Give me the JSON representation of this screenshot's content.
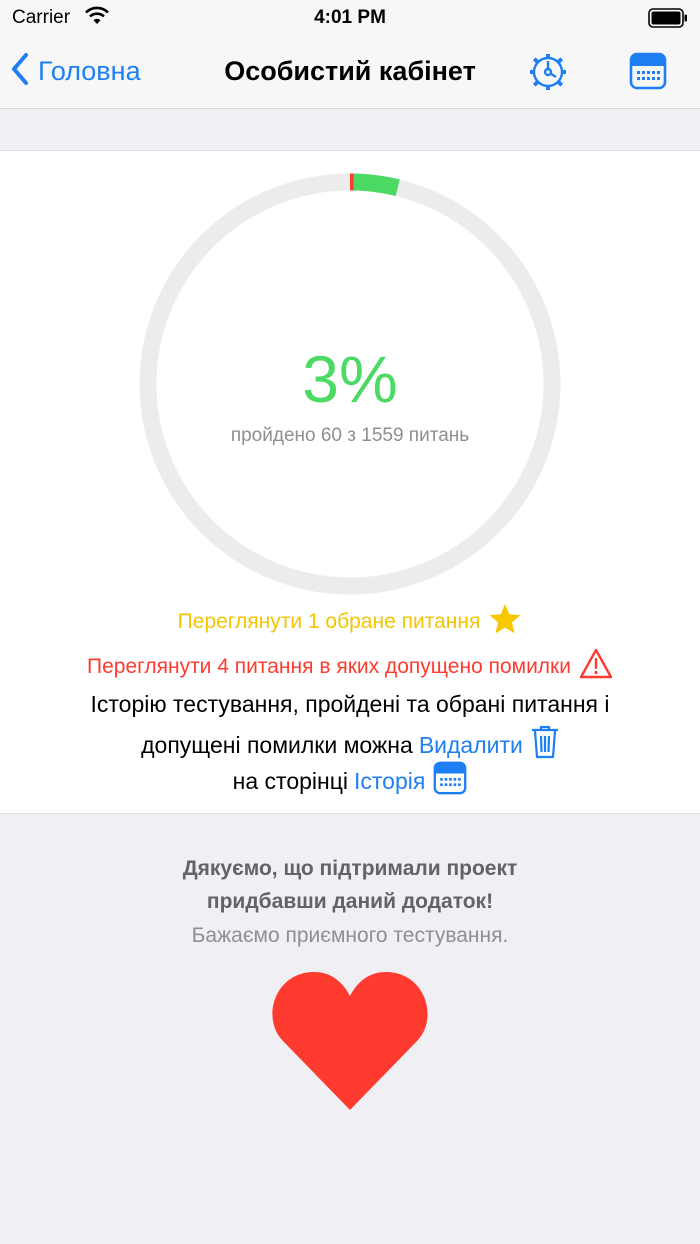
{
  "status_bar": {
    "carrier": "Carrier",
    "time": "4:01 PM"
  },
  "nav": {
    "back_label": "Головна",
    "title": "Особистий кабінет",
    "settings_icon": "settings-gear-icon",
    "calendar_icon": "calendar-icon"
  },
  "progress": {
    "percent_text": "3%",
    "passed_text": "пройдено 60 з 1559 питань",
    "fraction_correct": 0.035,
    "fraction_wrong": 0.003,
    "color_correct": "#4cd964",
    "color_wrong": "#ff3b30",
    "color_track": "#ececec"
  },
  "links": {
    "favorites_text": "Переглянути 1 обране питання",
    "favorites_color": "#f2c500",
    "errors_text": "Переглянути 4 питання в яких допущено помилки",
    "errors_color": "#ff3b30"
  },
  "info": {
    "line1": "Історію тестування, пройдені та обрані питання і",
    "line2_prefix": "допущені помилки можна",
    "delete_label": "Видалити",
    "line3_prefix": "на сторінці",
    "history_label": "Історія"
  },
  "thanks": {
    "line1": "Дякуємо, що підтримали проект",
    "line2": "придбавши даний додаток!",
    "wish": "Бажаємо приємного тестування."
  },
  "accent_color": "#1e7ff5",
  "heart_color": "#ff3b30"
}
